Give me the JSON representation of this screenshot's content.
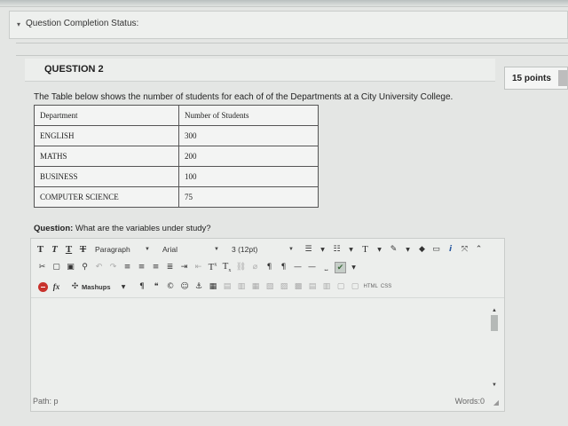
{
  "status": {
    "caret": "▾",
    "label": "Question Completion Status:"
  },
  "question": {
    "title": "QUESTION 2",
    "points": "15 points",
    "prompt": "The Table below shows the number of students for each of of the Departments at a City University College.",
    "table": {
      "headers": [
        "Department",
        "Number of Students"
      ],
      "rows": [
        [
          "ENGLISH",
          "300"
        ],
        [
          "MATHS",
          "200"
        ],
        [
          "BUSINESS",
          "100"
        ],
        [
          "COMPUTER SCIENCE",
          "75"
        ]
      ]
    },
    "sub_label": "Question:",
    "sub_text": " What are the variables under study?"
  },
  "editor": {
    "toolbar1": {
      "t1": "T",
      "t2": "T",
      "t3": "T",
      "t4": "T",
      "paragraph": "Paragraph",
      "font": "Arial",
      "size": "3 (12pt)"
    },
    "toolbar3": {
      "fx": "fx",
      "mashups": "Mashups",
      "html": "HTML",
      "css": "CSS"
    },
    "footer": {
      "path": "Path: p",
      "words": "Words:0"
    }
  },
  "colors": {
    "background": "#e4e6e4",
    "table_border": "#555555",
    "mashup_red": "#c8322c"
  }
}
